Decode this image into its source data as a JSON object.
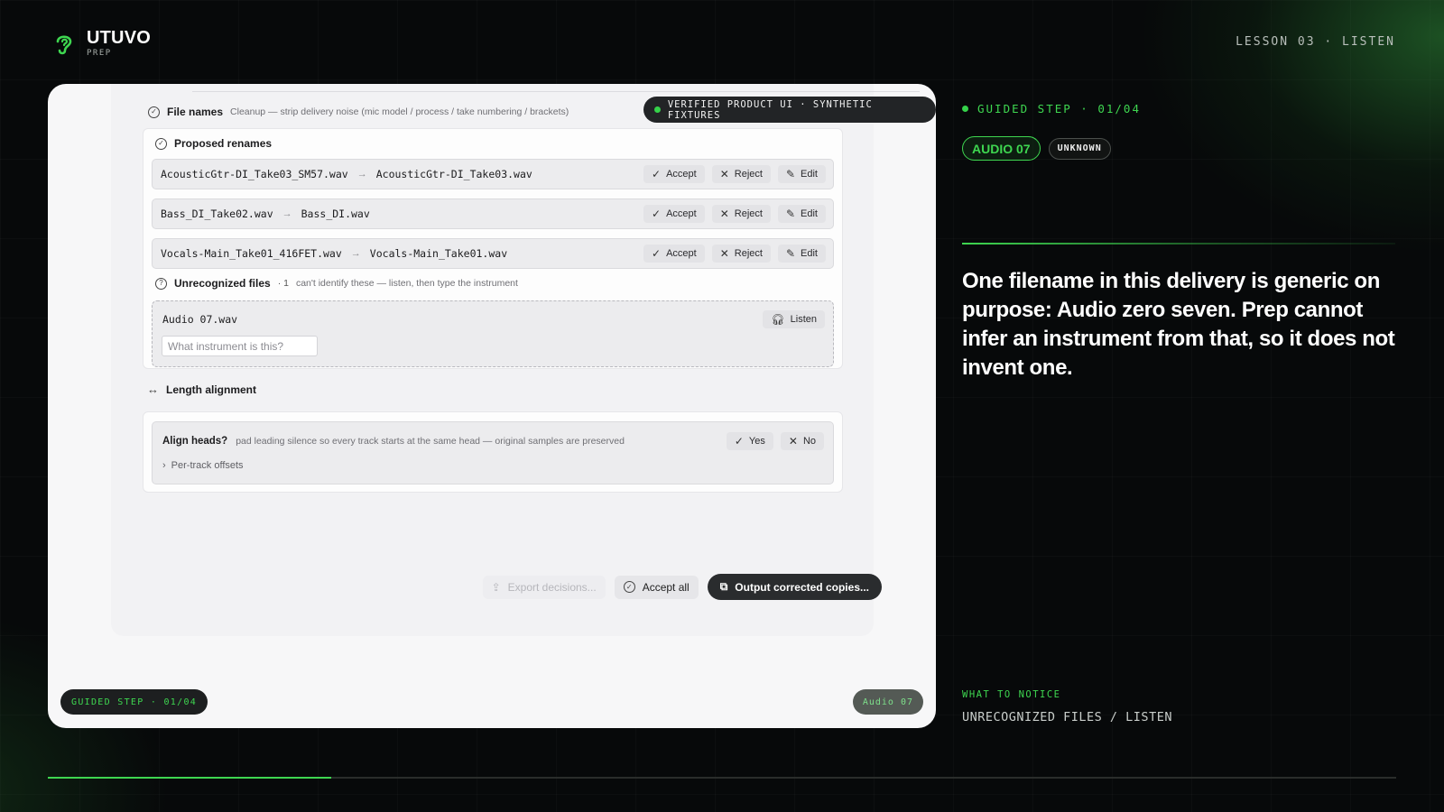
{
  "brand": {
    "name": "UTUVO",
    "sub": "PREP"
  },
  "lesson": "LESSON 03 · LISTEN",
  "badge_verified": "VERIFIED PRODUCT UI · SYNTHETIC FIXTURES",
  "file_names": {
    "title": "File names",
    "description": "Cleanup — strip delivery noise (mic model / process / take numbering / brackets)",
    "proposed_title": "Proposed renames",
    "renames": [
      {
        "from": "AcousticGtr-DI_Take03_SM57.wav",
        "to": "AcousticGtr-DI_Take03.wav"
      },
      {
        "from": "Bass_DI_Take02.wav",
        "to": "Bass_DI.wav"
      },
      {
        "from": "Vocals-Main_Take01_416FET.wav",
        "to": "Vocals-Main_Take01.wav"
      }
    ],
    "labels": {
      "accept": "Accept",
      "reject": "Reject",
      "edit": "Edit"
    }
  },
  "unrecognized": {
    "title": "Unrecognized files",
    "count": "· 1",
    "description": "can't identify these — listen, then type the instrument",
    "file": "Audio 07.wav",
    "listen_label": "Listen",
    "input_placeholder": "What instrument is this?"
  },
  "length_alignment": {
    "title": "Length alignment",
    "question": "Align heads?",
    "description": "pad leading silence so every track starts at the same head — original samples are preserved",
    "yes": "Yes",
    "no": "No",
    "offsets_label": "Per-track offsets"
  },
  "footer": {
    "export": "Export decisions...",
    "accept_all": "Accept all",
    "output": "Output corrected copies..."
  },
  "pill_step": "GUIDED STEP · 01/04",
  "pill_audio": "Audio 07",
  "right": {
    "guided": "GUIDED STEP · 01/04",
    "tag_audio": "AUDIO 07",
    "tag_unknown": "UNKNOWN",
    "headline": "One filename in this delivery is generic on purpose: Audio zero seven. Prep cannot infer an instrument from that, so it does not invent one.",
    "notice_label": "WHAT TO NOTICE",
    "notice_value": "UNRECOGNIZED FILES / LISTEN"
  },
  "progress": {
    "fraction": 0.21
  },
  "colors": {
    "accent": "#3ed650",
    "background": "#07090a",
    "card": "#f7f7f8",
    "dark_button": "#2a2c2e"
  }
}
